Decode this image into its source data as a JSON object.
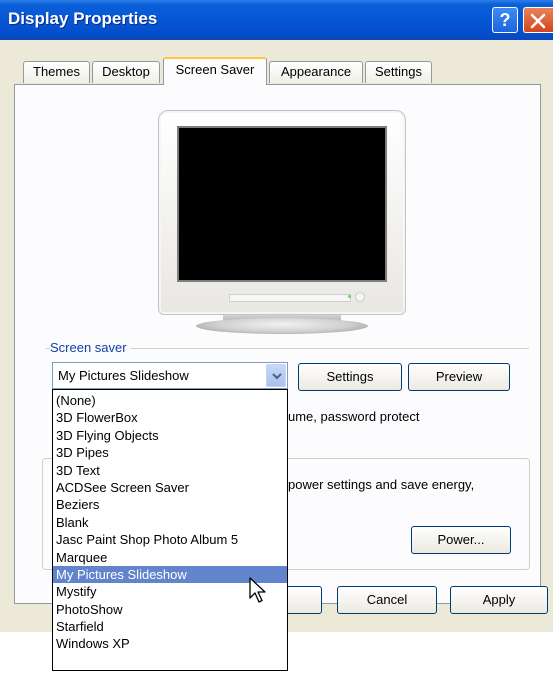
{
  "window": {
    "title": "Display Properties",
    "help_label": "?"
  },
  "tabs": [
    {
      "label": "Themes"
    },
    {
      "label": "Desktop"
    },
    {
      "label": "Screen Saver",
      "active": true
    },
    {
      "label": "Appearance"
    },
    {
      "label": "Settings"
    }
  ],
  "screen_saver": {
    "group_label": "Screen saver",
    "selected": "My Pictures Slideshow",
    "settings_button": "Settings",
    "preview_button": "Preview",
    "resume_text": "ume, password protect",
    "power_text": "power settings and save energy,",
    "power_button": "Power..."
  },
  "dropdown": {
    "options": [
      "(None)",
      "3D FlowerBox",
      "3D Flying Objects",
      "3D Pipes",
      "3D Text",
      "ACDSee Screen Saver",
      "Beziers",
      "Blank",
      "Jasc Paint Shop Photo Album 5",
      "Marquee",
      "My Pictures Slideshow",
      "Mystify",
      "PhotoShow",
      "Starfield",
      "Windows XP"
    ],
    "highlighted_index": 10
  },
  "footer": {
    "cancel_button": "Cancel",
    "apply_button": "Apply"
  },
  "colors": {
    "titlebar": "#0656d6",
    "highlight": "#6284cc",
    "group_label": "#1440a8"
  }
}
